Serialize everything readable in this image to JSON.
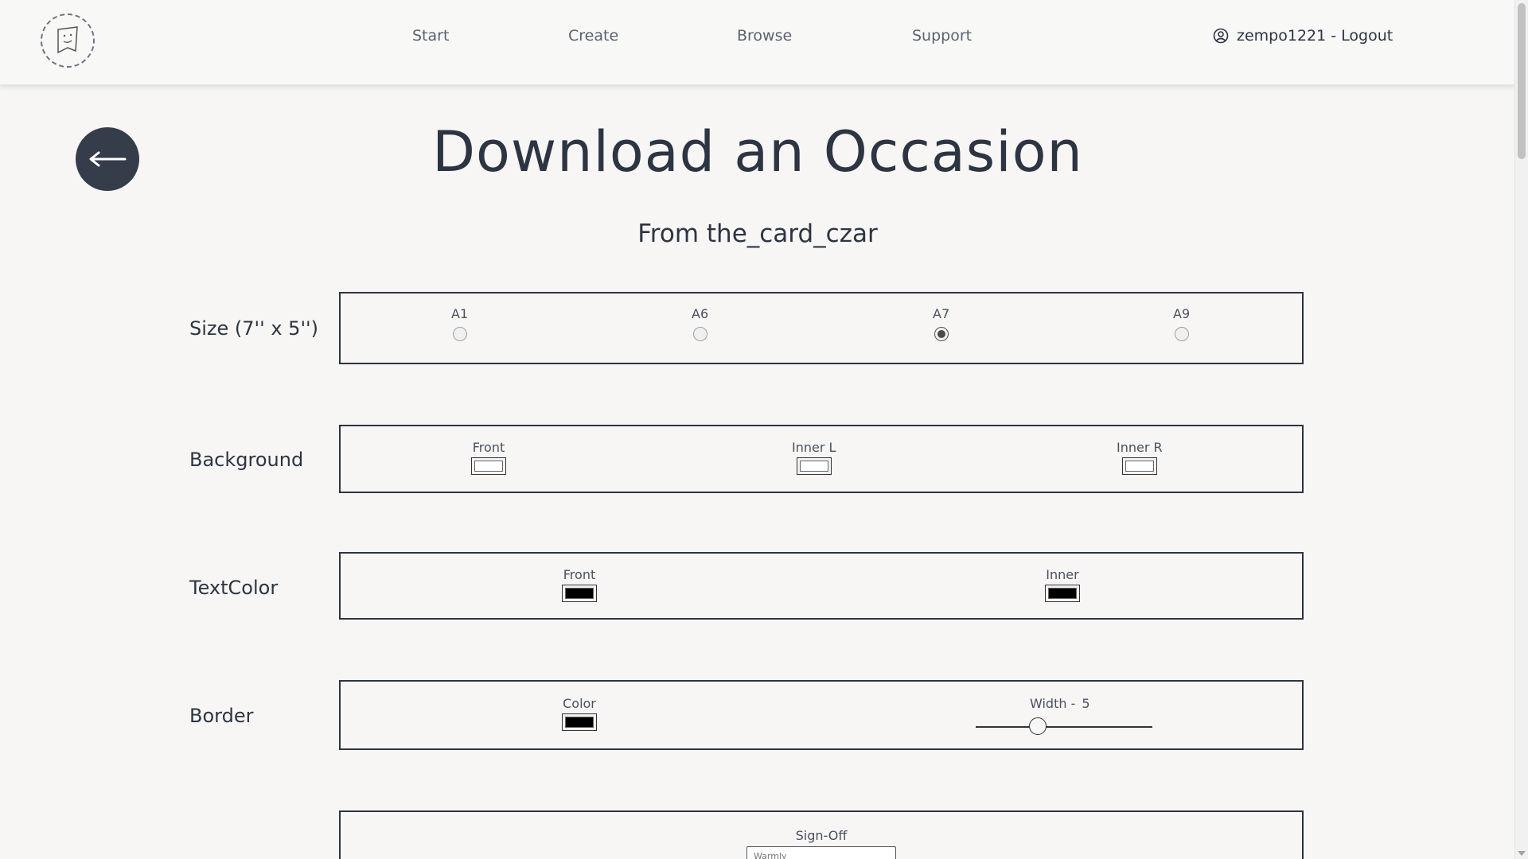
{
  "nav": {
    "links": [
      "Start",
      "Create",
      "Browse",
      "Support"
    ],
    "user_label": "zempo1221 - Logout"
  },
  "page": {
    "title": "Download an Occasion",
    "subtitle": "From the_card_czar"
  },
  "size": {
    "label": "Size (7'' x 5'')",
    "options": [
      "A1",
      "A6",
      "A7",
      "A9"
    ],
    "selected": "A7"
  },
  "background": {
    "label": "Background",
    "options": [
      {
        "label": "Front",
        "color": "#ffffff"
      },
      {
        "label": "Inner L",
        "color": "#ffffff"
      },
      {
        "label": "Inner R",
        "color": "#ffffff"
      }
    ]
  },
  "textcolor": {
    "label": "TextColor",
    "options": [
      {
        "label": "Front",
        "color": "#000000"
      },
      {
        "label": "Inner",
        "color": "#000000"
      }
    ]
  },
  "border": {
    "label": "Border",
    "color_label": "Color",
    "color": "#000000",
    "width_label": "Width -",
    "width_value": "5",
    "width_fraction": 0.35
  },
  "signoff": {
    "label": "Sign-Off",
    "placeholder": "Warmly"
  }
}
